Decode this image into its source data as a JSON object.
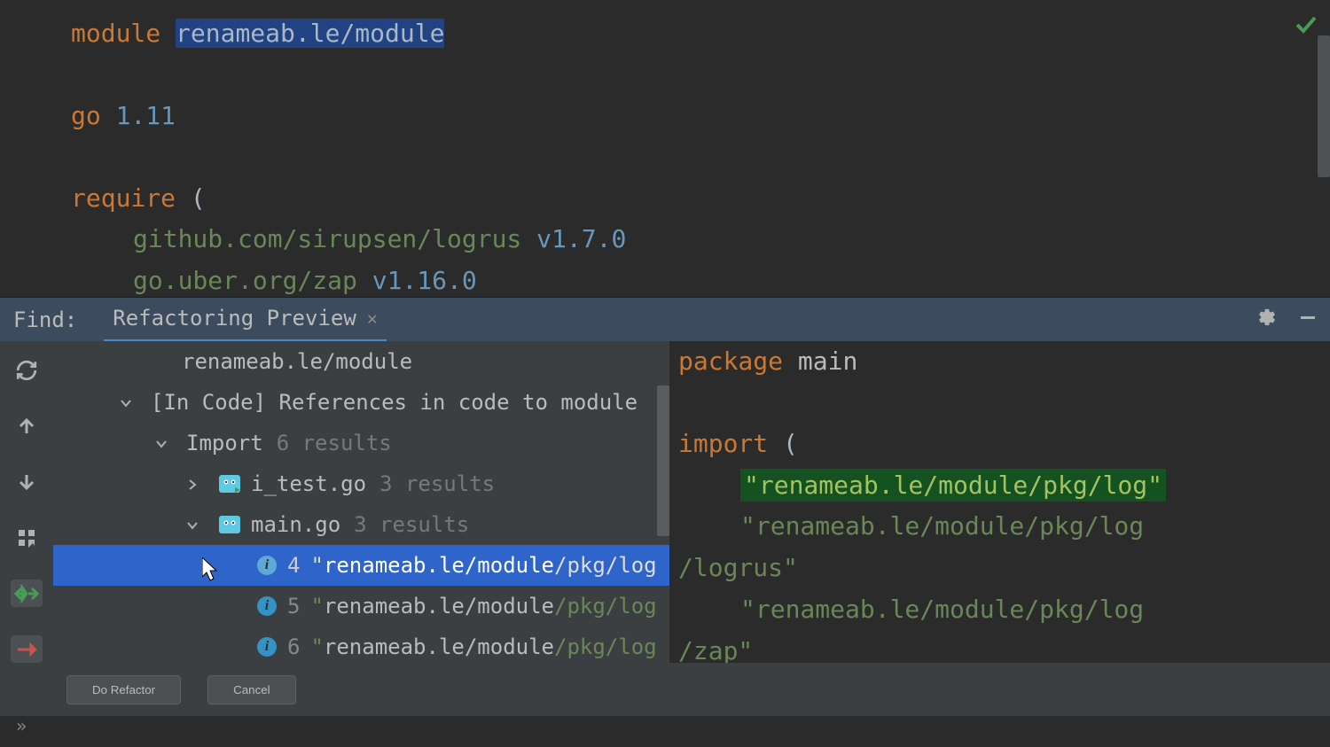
{
  "editor": {
    "line1_kw": "module",
    "line1_val": "renameab.le/module",
    "line2_kw": "go",
    "line2_val": "1.11",
    "line3_kw": "require",
    "line3_paren": "(",
    "dep1_name": "github.com/sirupsen/logrus",
    "dep1_ver": "v1.7.0",
    "dep2_name": "go.uber.org/zap",
    "dep2_ver": "v1.16.0"
  },
  "find": {
    "label": "Find:",
    "tab_title": "Refactoring Preview",
    "tree": {
      "root": "renameab.le/module",
      "heading": "[In Code] References in code to module",
      "import_label": "Import",
      "import_count": "6 results",
      "file1": "i_test.go",
      "file1_count": "3 results",
      "file2": "main.go",
      "file2_count": "3 results",
      "match1_line": "4",
      "match1_quote": "\"",
      "match1_hl": "renameab.le/module",
      "match1_rest": "/pkg/log",
      "match2_line": "5",
      "match2_hl": "renameab.le/module",
      "match2_rest": "/pkg/log",
      "match3_line": "6",
      "match3_hl": "renameab.le/module",
      "match3_rest": "/pkg/log"
    },
    "preview": {
      "package_kw": "package",
      "package_name": "main",
      "import_kw": "import",
      "import_paren": "(",
      "s1": "\"renameab.le/module/pkg/log\"",
      "s2a": "\"renameab.le/module/pkg/log",
      "s2b": "/logrus\"",
      "s3a": "\"renameab.le/module/pkg/log",
      "s3b": "/zap\""
    },
    "buttons": {
      "refactor": "Do Refactor",
      "cancel": "Cancel"
    }
  }
}
